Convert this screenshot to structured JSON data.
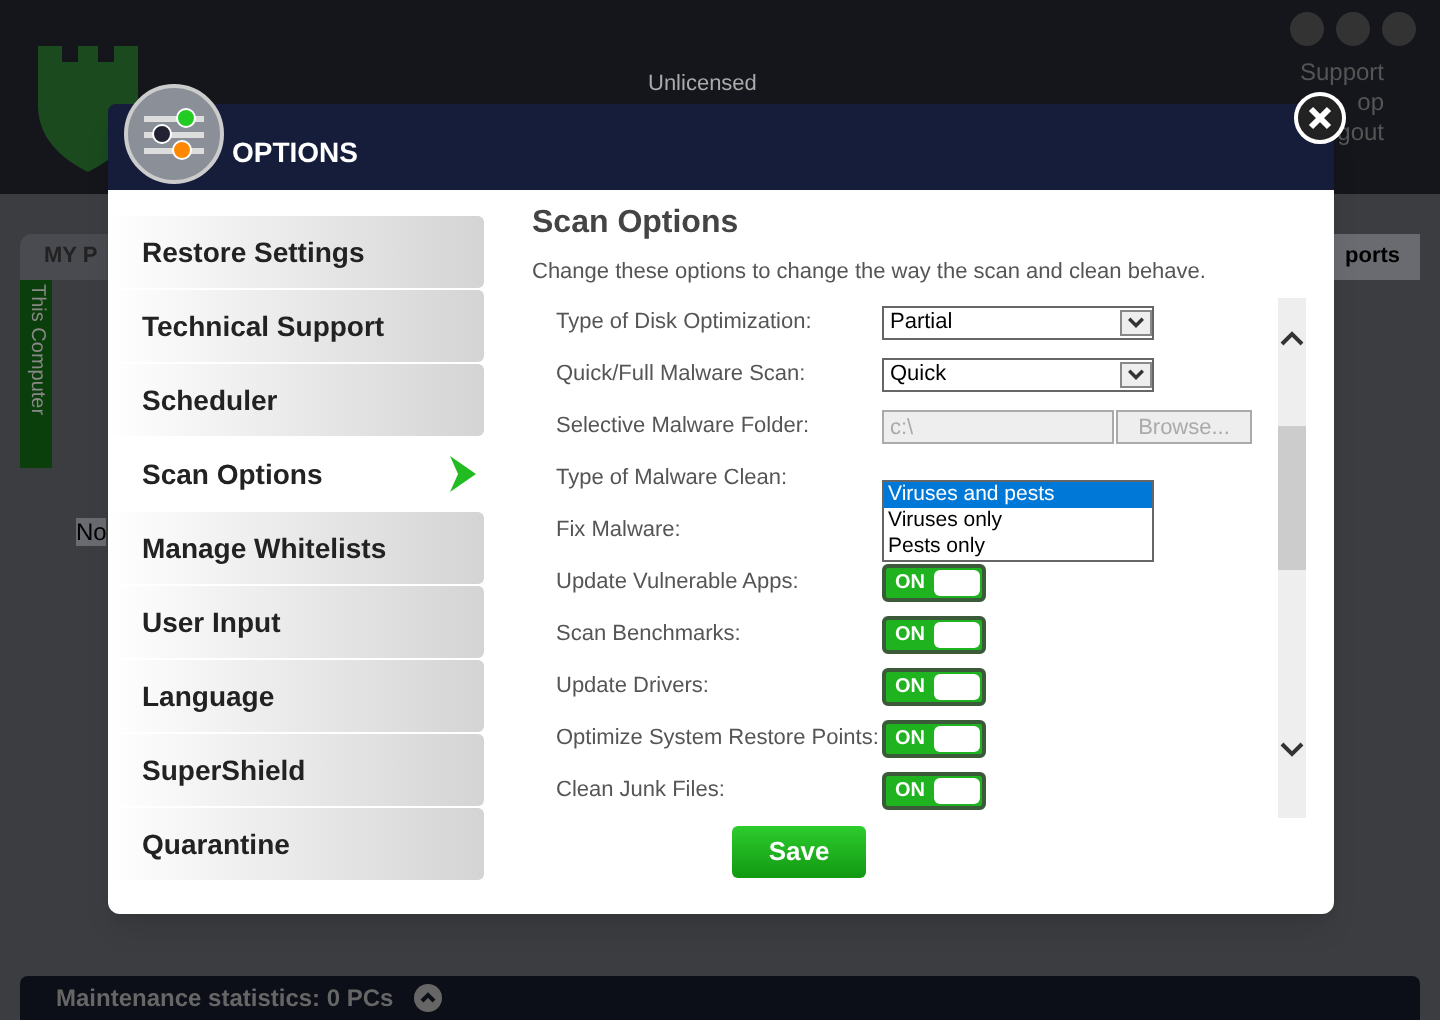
{
  "background": {
    "license": "Unlicensed",
    "links": [
      "Support",
      "op",
      "gout"
    ],
    "tab": "MY P",
    "side_tab": "This Computer",
    "panel_text": "No",
    "right_tab": "ports",
    "status_bar": "Maintenance statistics: 0 PCs"
  },
  "dialog": {
    "title": "OPTIONS",
    "menu": [
      {
        "label": "Restore Settings",
        "selected": false
      },
      {
        "label": "Technical Support",
        "selected": false
      },
      {
        "label": "Scheduler",
        "selected": false
      },
      {
        "label": "Scan Options",
        "selected": true
      },
      {
        "label": "Manage Whitelists",
        "selected": false
      },
      {
        "label": "User Input",
        "selected": false
      },
      {
        "label": "Language",
        "selected": false
      },
      {
        "label": "SuperShield",
        "selected": false
      },
      {
        "label": "Quarantine",
        "selected": false
      }
    ],
    "heading": "Scan Options",
    "description": "Change these options to change the way the scan and clean behave.",
    "options": [
      {
        "kind": "select",
        "label": "Type of Disk Optimization:",
        "value": "Partial"
      },
      {
        "kind": "select",
        "label": "Quick/Full Malware Scan:",
        "value": "Quick"
      },
      {
        "kind": "folder",
        "label": "Selective Malware Folder:",
        "value": "c:\\",
        "button": "Browse...",
        "disabled": true
      },
      {
        "kind": "list",
        "label": "Type of Malware Clean:",
        "choices": [
          {
            "label": "Viruses and pests",
            "selected": true
          },
          {
            "label": "Viruses only",
            "selected": false
          },
          {
            "label": "Pests only",
            "selected": false
          }
        ]
      },
      {
        "kind": "label",
        "label": "Fix Malware:"
      },
      {
        "kind": "toggle",
        "label": "Update Vulnerable Apps:",
        "on": true,
        "text": "ON"
      },
      {
        "kind": "toggle",
        "label": "Scan Benchmarks:",
        "on": true,
        "text": "ON"
      },
      {
        "kind": "toggle",
        "label": "Update Drivers:",
        "on": true,
        "text": "ON"
      },
      {
        "kind": "toggle",
        "label": "Optimize System Restore Points:",
        "on": true,
        "text": "ON"
      },
      {
        "kind": "toggle",
        "label": "Clean Junk Files:",
        "on": true,
        "text": "ON"
      }
    ],
    "save": "Save"
  }
}
